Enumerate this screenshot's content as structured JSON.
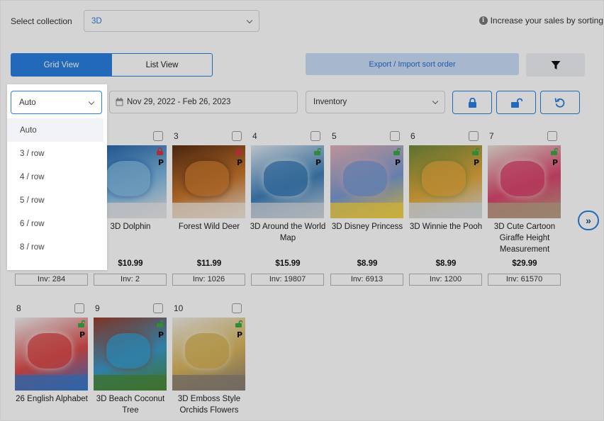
{
  "header": {
    "collection_label": "Select collection",
    "collection_value": "3D",
    "info_text": "Increase your sales by sorting"
  },
  "view_toggle": {
    "grid_label": "Grid View",
    "list_label": "List View",
    "active": "grid"
  },
  "export_label": "Export / Import sort order",
  "filters": {
    "per_row_value": "Auto",
    "date_range": "Nov 29, 2022 - Feb 26, 2023",
    "sort_value": "Inventory"
  },
  "dropdown": {
    "options": [
      "Auto",
      "3 / row",
      "4 / row",
      "5 / row",
      "6 / row",
      "8 / row"
    ],
    "selected": "Auto"
  },
  "products": [
    {
      "num": "",
      "name": "",
      "price": "$16.99",
      "inv": "Inv: 284",
      "locked": false,
      "colors": [
        "#2b4b8a",
        "#c7a35e",
        "#8f2e3f"
      ]
    },
    {
      "num": "",
      "name": "3D Dolphin",
      "price": "$10.99",
      "inv": "Inv: 2",
      "locked": true,
      "colors": [
        "#1f5fa8",
        "#7fb8e0",
        "#e8e8ea"
      ]
    },
    {
      "num": "3",
      "name": "Forest Wild Deer",
      "price": "$11.99",
      "inv": "Inv: 1026",
      "locked": true,
      "colors": [
        "#5a2e12",
        "#c8772e",
        "#f0e6da"
      ]
    },
    {
      "num": "4",
      "name": "3D Around the World Map",
      "price": "$15.99",
      "inv": "Inv: 19807",
      "locked": false,
      "colors": [
        "#dfe9f1",
        "#3f7fb8",
        "#cfd7de"
      ]
    },
    {
      "num": "5",
      "name": "3D Disney Princess",
      "price": "$8.99",
      "inv": "Inv: 6913",
      "locked": false,
      "colors": [
        "#e4b1b7",
        "#7a9ad0",
        "#f3d24a"
      ]
    },
    {
      "num": "6",
      "name": "3D Winnie the Pooh",
      "price": "$8.99",
      "inv": "Inv: 1200",
      "locked": false,
      "colors": [
        "#6f8a3a",
        "#e0a73c",
        "#d9e0e6"
      ]
    },
    {
      "num": "7",
      "name": "3D Cute Cartoon Giraffe Height Measurement",
      "price": "$29.99",
      "inv": "Inv: 61570",
      "locked": false,
      "colors": [
        "#e9e1d6",
        "#d9466e",
        "#b9a186"
      ]
    },
    {
      "num": "8",
      "name": "26 English Alphabet",
      "price": "",
      "inv": "",
      "locked": false,
      "colors": [
        "#f2f2f2",
        "#d94c4c",
        "#3c78c8"
      ]
    },
    {
      "num": "9",
      "name": "3D Beach Coconut Tree",
      "price": "",
      "inv": "",
      "locked": false,
      "colors": [
        "#9a3e2a",
        "#3a9ac9",
        "#4b8a3a"
      ]
    },
    {
      "num": "10",
      "name": "3D Emboss Style Orchids Flowers",
      "price": "",
      "inv": "",
      "locked": false,
      "colors": [
        "#efece6",
        "#d7b45a",
        "#8a7f76"
      ]
    }
  ],
  "p_badge": "P",
  "colors": {
    "accent": "#2b7fe0",
    "lock_red": "#d9363e",
    "lock_green": "#3aa845"
  }
}
